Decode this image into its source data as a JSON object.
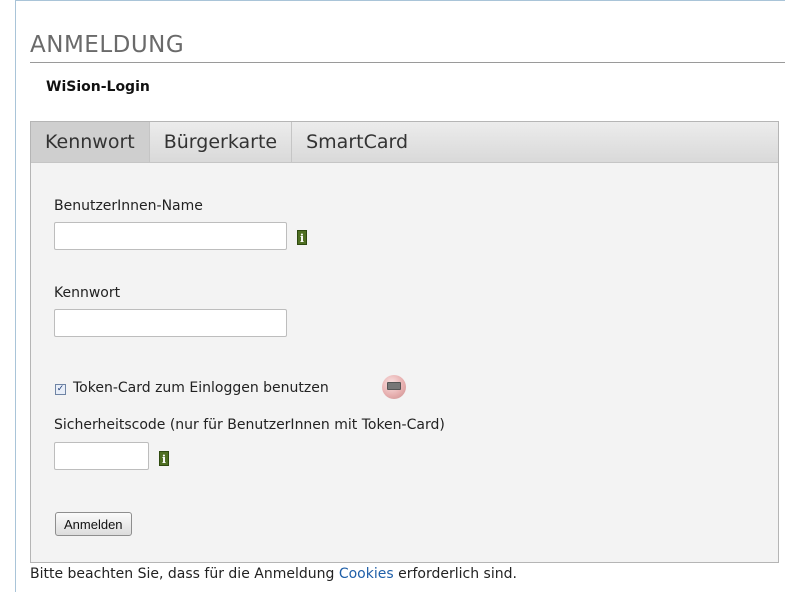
{
  "page": {
    "title": "ANMELDUNG",
    "subtitle": "WiSion-Login"
  },
  "tabs": [
    {
      "label": "Kennwort",
      "active": true
    },
    {
      "label": "Bürgerkarte",
      "active": false
    },
    {
      "label": "SmartCard",
      "active": false
    }
  ],
  "form": {
    "username_label": "BenutzerInnen-Name",
    "username_value": "",
    "password_label": "Kennwort",
    "password_value": "",
    "token_checkbox_label": "Token-Card zum Einloggen benutzen",
    "token_checked": true,
    "security_code_label": "Sicherheitscode (nur für BenutzerInnen mit Token-Card)",
    "security_code_value": "",
    "info_glyph": "i",
    "submit_label": "Anmelden"
  },
  "note": {
    "before": "Bitte beachten Sie, dass für die Anmeldung",
    "link": "Cookies",
    "after": "erforderlich sind."
  },
  "colors": {
    "info_badge": "#4f6f22",
    "link": "#1f5fa8",
    "title": "#6a6a6a"
  },
  "icons": {
    "info": "info-icon",
    "token": "token-card-icon",
    "checkbox": "checkbox-checked"
  }
}
